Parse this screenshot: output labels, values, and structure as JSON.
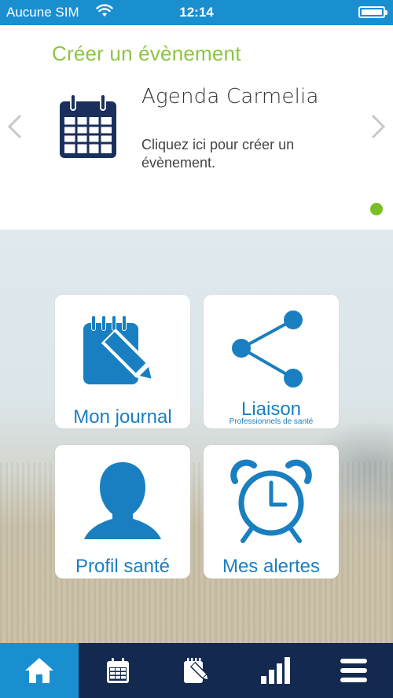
{
  "status_bar": {
    "carrier": "Aucune SIM",
    "time": "12:14"
  },
  "carousel": {
    "heading": "Créer un évènement",
    "event_title": "Agenda Carmelia",
    "event_description": "Cliquez ici pour créer un évènement."
  },
  "tiles": [
    {
      "label": "Mon journal",
      "icon": "notepad-pencil-icon"
    },
    {
      "label": "Liaison",
      "sublabel": "Professionnels de santé",
      "icon": "share-icon"
    },
    {
      "label": "Profil santé",
      "icon": "person-silhouette-icon"
    },
    {
      "label": "Mes alertes",
      "icon": "alarm-clock-icon"
    }
  ],
  "tab_bar": {
    "items": [
      {
        "icon": "home-icon",
        "active": true
      },
      {
        "icon": "calendar-icon",
        "active": false
      },
      {
        "icon": "journal-edit-icon",
        "active": false
      },
      {
        "icon": "bar-chart-icon",
        "active": false
      },
      {
        "icon": "menu-icon",
        "active": false
      }
    ]
  },
  "colors": {
    "status_bar": "#1a8fd0",
    "accent_green": "#8cc63f",
    "tile_blue": "#1a7fc0",
    "tab_bar": "#14294f",
    "tab_active": "#1a8fd0"
  }
}
